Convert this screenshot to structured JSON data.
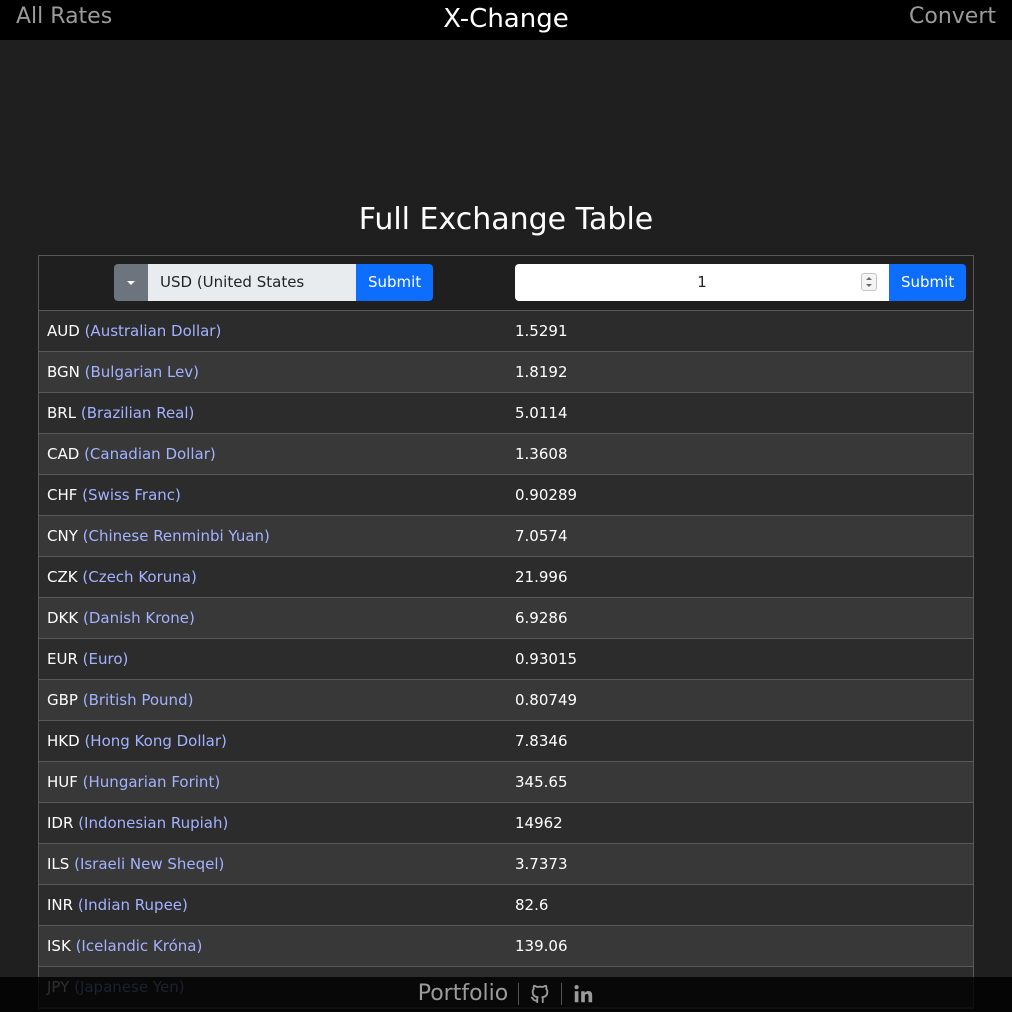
{
  "nav": {
    "left_link": "All Rates",
    "brand": "X-Change",
    "right_link": "Convert"
  },
  "page": {
    "title": "Full Exchange Table"
  },
  "controls": {
    "base_currency": "USD (United States Dollar)",
    "base_submit": "Submit",
    "amount": "1",
    "amount_submit": "Submit"
  },
  "rates": [
    {
      "code": "AUD",
      "name": "(Australian Dollar)",
      "rate": "1.5291"
    },
    {
      "code": "BGN",
      "name": "(Bulgarian Lev)",
      "rate": "1.8192"
    },
    {
      "code": "BRL",
      "name": "(Brazilian Real)",
      "rate": "5.0114"
    },
    {
      "code": "CAD",
      "name": "(Canadian Dollar)",
      "rate": "1.3608"
    },
    {
      "code": "CHF",
      "name": "(Swiss Franc)",
      "rate": "0.90289"
    },
    {
      "code": "CNY",
      "name": "(Chinese Renminbi Yuan)",
      "rate": "7.0574"
    },
    {
      "code": "CZK",
      "name": "(Czech Koruna)",
      "rate": "21.996"
    },
    {
      "code": "DKK",
      "name": "(Danish Krone)",
      "rate": "6.9286"
    },
    {
      "code": "EUR",
      "name": "(Euro)",
      "rate": "0.93015"
    },
    {
      "code": "GBP",
      "name": "(British Pound)",
      "rate": "0.80749"
    },
    {
      "code": "HKD",
      "name": "(Hong Kong Dollar)",
      "rate": "7.8346"
    },
    {
      "code": "HUF",
      "name": "(Hungarian Forint)",
      "rate": "345.65"
    },
    {
      "code": "IDR",
      "name": "(Indonesian Rupiah)",
      "rate": "14962"
    },
    {
      "code": "ILS",
      "name": "(Israeli New Sheqel)",
      "rate": "3.7373"
    },
    {
      "code": "INR",
      "name": "(Indian Rupee)",
      "rate": "82.6"
    },
    {
      "code": "ISK",
      "name": "(Icelandic Króna)",
      "rate": "139.06"
    },
    {
      "code": "JPY",
      "name": "(Japanese Yen)",
      "rate": ""
    }
  ],
  "footer": {
    "portfolio": "Portfolio",
    "icons": [
      "github-icon",
      "linkedin-icon"
    ]
  },
  "colors": {
    "background": "#1f1f1f",
    "navbar": "#000000",
    "accent_button": "#0d6efd",
    "currency_name": "#a3b2ff",
    "row_odd": "#2c2c2c",
    "row_even": "#383838"
  }
}
